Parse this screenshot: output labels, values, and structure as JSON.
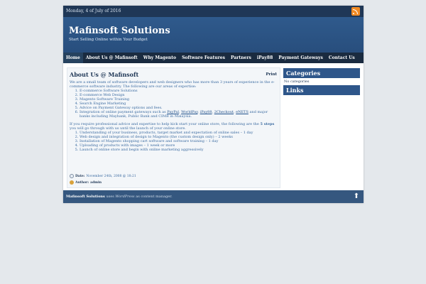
{
  "topbar": {
    "date": "Monday, 4 of July of 2016",
    "rss_icon": "rss-icon"
  },
  "header": {
    "title": "Mafinsoft Solutions",
    "tagline": "Start Selling Online within Your Budget"
  },
  "nav": {
    "items": [
      "Home",
      "About Us @ Mafinsoft",
      "Why Magento",
      "Software Features",
      "Partners",
      "iPay88",
      "Payment Gateways",
      "Contact Us"
    ]
  },
  "post": {
    "title": "About Us @ Mafinsoft",
    "print": "Print",
    "intro": "We are a small team of software developers and web designers who has more than 3 years of experience in the  e-commerce software industry. The following are our areas of expertise:",
    "expertise": [
      "E-commerce Software Solutions",
      "E-commerce Web Design",
      "Magento Software Training",
      "Search Engine Marketing",
      "Advice on Payment Gateway options and fees."
    ],
    "integration_prefix": "Integration of online payment gateways such as ",
    "links": [
      "PayPal",
      "WorldPay",
      "iPay88",
      "2Checkout",
      "eNETS"
    ],
    "integration_suffix": " and major banks including Maybank, Public Bank and CIMB in Malaysia.",
    "advice_text": "If you require professional advice and expertise to help kick start your online store, the following are the ",
    "advice_bold": "5 steps",
    "advice_end": " you will go through with us until the launch of your online store.",
    "steps": [
      "Understanding of your business, products, target market and expectation of online sales – 1 day",
      "Web design and integration of design to Magento (the custom design only) – 2 weeks",
      "Installation of Magento shopping cart software and software training – 1 day",
      "Uploading of products with images – 1 week or more",
      "Launch of online store and begin with online marketing aggressively"
    ],
    "date_label": "Date:",
    "date_value": "November 24th, 2008 @ 18:21",
    "author_label": "Author:",
    "author_value": "admin"
  },
  "sidebar": {
    "categories_title": "Categories",
    "categories_empty": "No categories",
    "links_title": "Links"
  },
  "footer": {
    "site": "Mafinsoft Solutions",
    "uses": " uses ",
    "wordpress": "WordPress",
    "as": " as content manager.",
    "top_icon": "arrow-up-icon"
  }
}
